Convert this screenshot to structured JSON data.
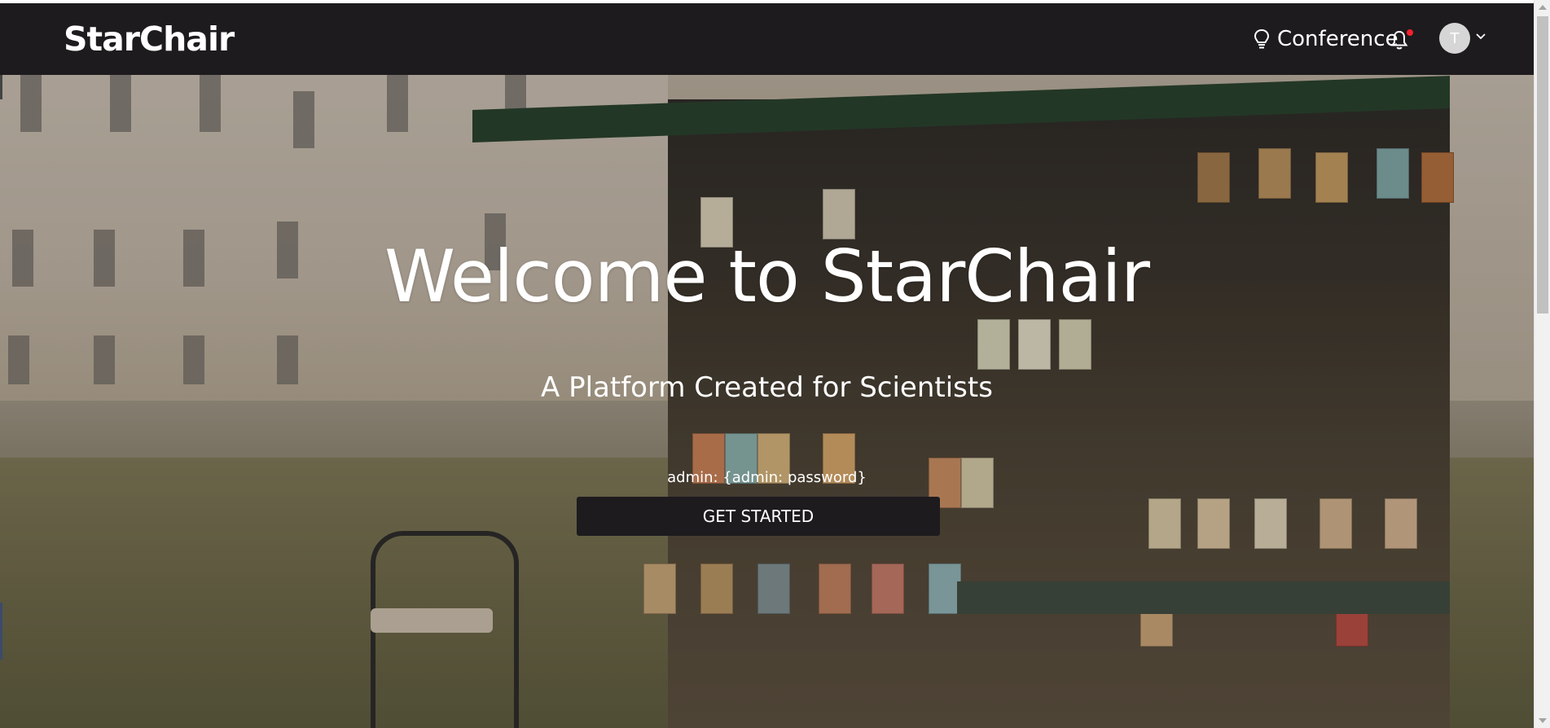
{
  "header": {
    "logo": "StarChair",
    "conference_label": "Conference",
    "avatar_initial": "T"
  },
  "hero": {
    "title": "Welcome to StarChair",
    "subtitle": "A Platform Created for Scientists",
    "note": "admin: {admin: password}",
    "cta_label": "GET STARTED"
  },
  "icons": {
    "conference": "lightbulb-icon",
    "notifications": "bell-icon",
    "avatar_dropdown": "chevron-down-icon",
    "scroll_up": "caret-up-icon",
    "scroll_down": "caret-down-icon"
  },
  "colors": {
    "header_bg": "#1d1b1e",
    "notification_dot": "#f5222d",
    "avatar_bg": "#d6d6d6",
    "cta_bg": "#1d1b1e",
    "text_light": "#ffffff"
  }
}
